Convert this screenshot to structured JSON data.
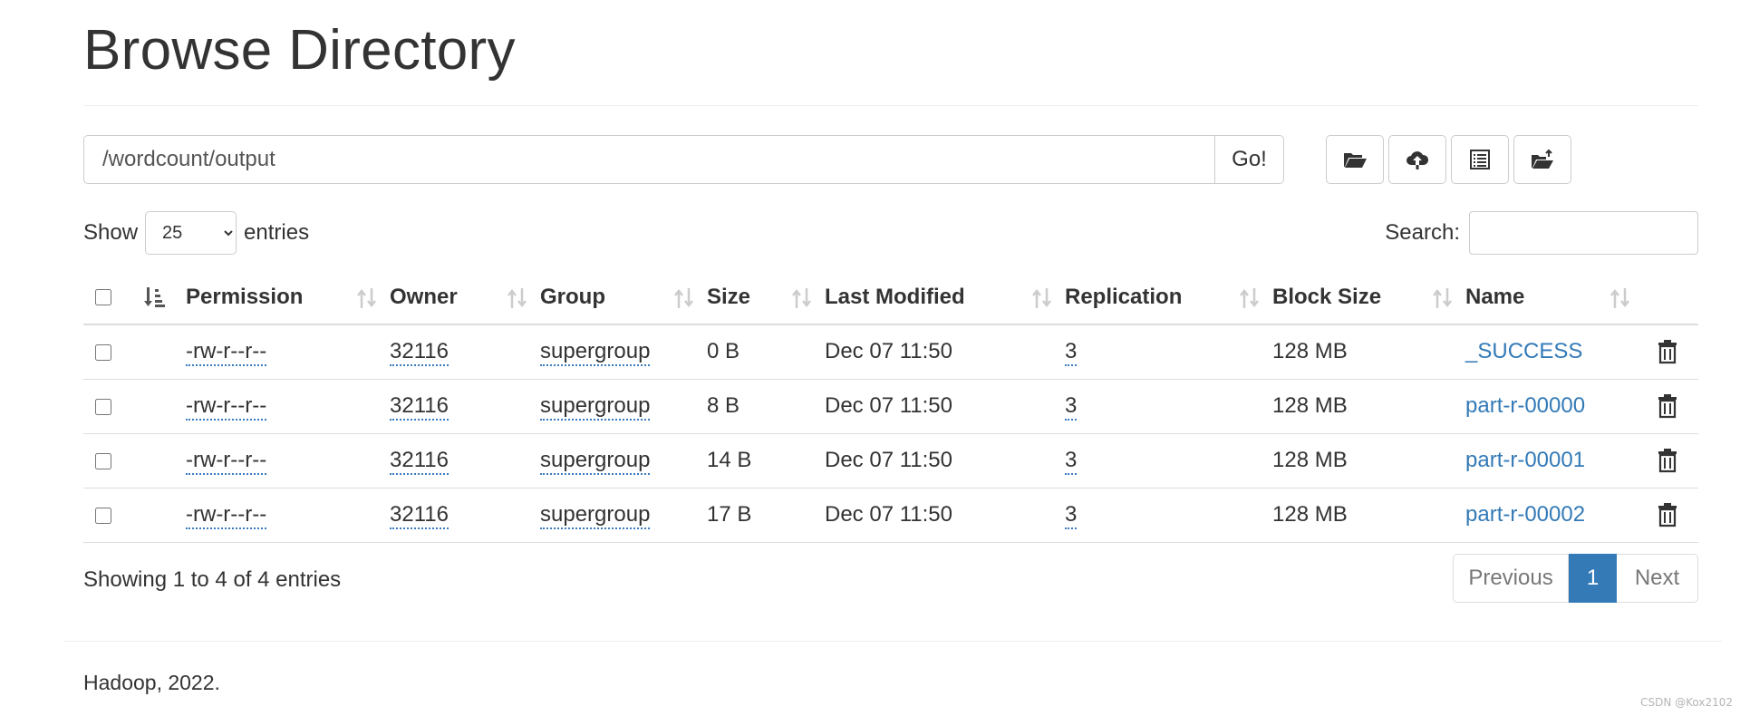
{
  "page": {
    "title": "Browse Directory"
  },
  "path_bar": {
    "value": "/wordcount/output",
    "go_label": "Go!"
  },
  "toolbar": {
    "buttons": [
      {
        "icon": "folder-open-icon"
      },
      {
        "icon": "cloud-upload-icon"
      },
      {
        "icon": "list-alt-icon"
      },
      {
        "icon": "folder-cut-icon"
      }
    ]
  },
  "length_control": {
    "show_label": "Show",
    "selected": "25",
    "entries_label": "entries"
  },
  "search": {
    "label": "Search:",
    "value": ""
  },
  "table": {
    "columns": [
      "Permission",
      "Owner",
      "Group",
      "Size",
      "Last Modified",
      "Replication",
      "Block Size",
      "Name"
    ],
    "rows": [
      {
        "permission": "-rw-r--r--",
        "owner": "32116",
        "group": "supergroup",
        "size": "0 B",
        "modified": "Dec 07 11:50",
        "replication": "3",
        "block_size": "128 MB",
        "name": "_SUCCESS"
      },
      {
        "permission": "-rw-r--r--",
        "owner": "32116",
        "group": "supergroup",
        "size": "8 B",
        "modified": "Dec 07 11:50",
        "replication": "3",
        "block_size": "128 MB",
        "name": "part-r-00000"
      },
      {
        "permission": "-rw-r--r--",
        "owner": "32116",
        "group": "supergroup",
        "size": "14 B",
        "modified": "Dec 07 11:50",
        "replication": "3",
        "block_size": "128 MB",
        "name": "part-r-00001"
      },
      {
        "permission": "-rw-r--r--",
        "owner": "32116",
        "group": "supergroup",
        "size": "17 B",
        "modified": "Dec 07 11:50",
        "replication": "3",
        "block_size": "128 MB",
        "name": "part-r-00002"
      }
    ]
  },
  "info": "Showing 1 to 4 of 4 entries",
  "pagination": {
    "previous": "Previous",
    "current": "1",
    "next": "Next"
  },
  "footer": "Hadoop, 2022.",
  "watermark": "CSDN @Kox2102",
  "colors": {
    "link": "#337ab7",
    "active_page": "#337ab7",
    "border": "#dddddd"
  }
}
